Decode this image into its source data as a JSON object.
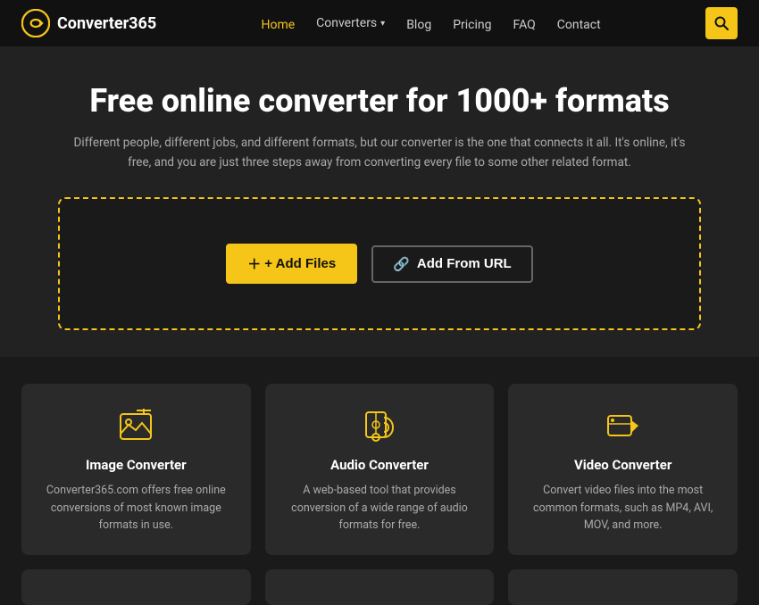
{
  "nav": {
    "logo_text": "Converter365",
    "links": [
      {
        "label": "Home",
        "active": true
      },
      {
        "label": "Converters",
        "has_dropdown": true,
        "active": false
      },
      {
        "label": "Blog",
        "active": false
      },
      {
        "label": "Pricing",
        "active": false
      },
      {
        "label": "FAQ",
        "active": false
      },
      {
        "label": "Contact",
        "active": false
      }
    ],
    "search_icon": "🔍"
  },
  "hero": {
    "title": "Free online converter for 1000+ formats",
    "subtitle": "Different people, different jobs, and different formats, but our converter is the one that connects it all. It's online, it's free, and you are just three steps away from converting every file to some other related format."
  },
  "dropzone": {
    "add_files_label": "+ Add Files",
    "add_url_label": "Add From URL"
  },
  "features": [
    {
      "id": "image",
      "title": "Image Converter",
      "description": "Converter365.com offers free online conversions of most known image formats in use."
    },
    {
      "id": "audio",
      "title": "Audio Converter",
      "description": "A web-based tool that provides conversion of a wide range of audio formats for free."
    },
    {
      "id": "video",
      "title": "Video Converter",
      "description": "Convert video files into the most common formats, such as MP4, AVI, MOV, and more."
    }
  ]
}
